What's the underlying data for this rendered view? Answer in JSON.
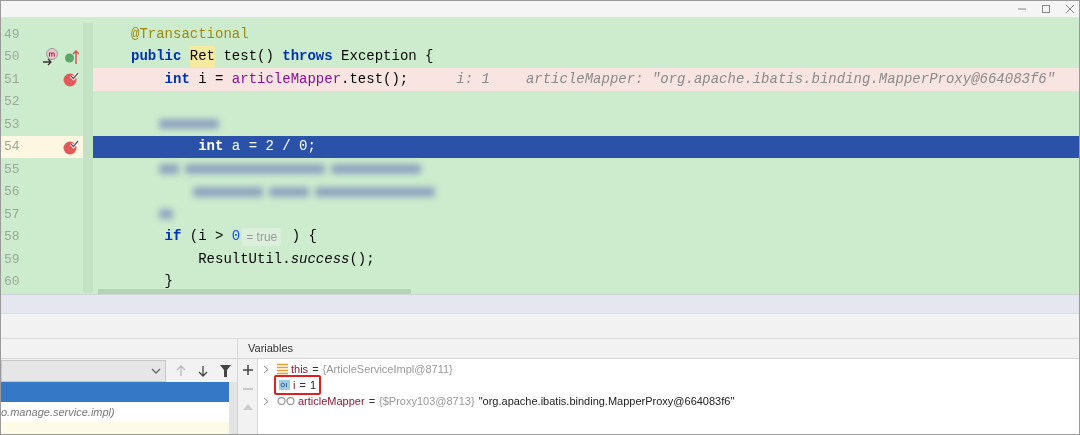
{
  "editor": {
    "lines": [
      {
        "number": "49",
        "breakpoint": false,
        "current": false,
        "blurred": false,
        "tokens": [
          {
            "kind": "annotation",
            "text": "@Transactional"
          }
        ]
      },
      {
        "number": "50",
        "breakpoint": false,
        "current": false,
        "blurred": false,
        "override": true,
        "implemented": true,
        "tokens": [
          {
            "kind": "keyword",
            "text": "public "
          },
          {
            "kind": "type",
            "text": "Ret"
          },
          {
            "kind": "plain",
            "text": " test() "
          },
          {
            "kind": "keyword",
            "text": "throws"
          },
          {
            "kind": "plain",
            "text": " Exception {"
          }
        ]
      },
      {
        "number": "51",
        "breakpoint": true,
        "current": false,
        "blurred": false,
        "tokens": [
          {
            "kind": "keyword",
            "text": "    int"
          },
          {
            "kind": "plain",
            "text": " i = "
          },
          {
            "kind": "field",
            "text": "articleMapper"
          },
          {
            "kind": "plain",
            "text": ".test();"
          }
        ],
        "hints": [
          "i: 1",
          "articleMapper: \"org.apache.ibatis.binding.MapperProxy@664083f6\""
        ]
      },
      {
        "number": "52",
        "breakpoint": false,
        "current": false,
        "blurred": false
      },
      {
        "number": "53",
        "breakpoint": false,
        "current": false,
        "blurred": true
      },
      {
        "number": "54",
        "breakpoint": true,
        "current": true,
        "blurred": false,
        "tokens": [
          {
            "kind": "keyword",
            "text": "        int"
          },
          {
            "kind": "plain",
            "text": " a = 2 / 0;"
          }
        ]
      },
      {
        "number": "55",
        "breakpoint": false,
        "current": false,
        "blurred": true
      },
      {
        "number": "56",
        "breakpoint": false,
        "current": false,
        "blurred": true
      },
      {
        "number": "57",
        "breakpoint": false,
        "current": false,
        "blurred": true
      },
      {
        "number": "58",
        "breakpoint": false,
        "current": false,
        "blurred": false,
        "tokens": [
          {
            "kind": "keyword",
            "text": "    if"
          },
          {
            "kind": "plain",
            "text": " (i > "
          },
          {
            "kind": "number",
            "text": "0"
          },
          {
            "kind": "inline-hint",
            "text": "= true"
          },
          {
            "kind": "plain",
            "text": " ) {"
          }
        ]
      },
      {
        "number": "59",
        "breakpoint": false,
        "current": false,
        "blurred": false,
        "tokens": [
          {
            "kind": "plain",
            "text": "        ResultUtil."
          },
          {
            "kind": "static",
            "text": "success"
          },
          {
            "kind": "plain",
            "text": "();"
          }
        ]
      },
      {
        "number": "60",
        "breakpoint": false,
        "current": false,
        "blurred": false,
        "tokens": [
          {
            "kind": "plain",
            "text": "    }"
          }
        ]
      }
    ]
  },
  "frames": {
    "items": [
      {
        "selected": true
      },
      {
        "label": "o.manage.service.impl)",
        "selected": false
      },
      {
        "selected": false,
        "kind": "library"
      }
    ]
  },
  "variables": {
    "title": "Variables",
    "rows": [
      {
        "kind": "object",
        "expandable": true,
        "highlighted": false,
        "name": "this",
        "operator": "=",
        "value": "{ArticleServiceImpl@8711}"
      },
      {
        "kind": "primitive",
        "expandable": false,
        "highlighted": true,
        "name": "i",
        "operator": "=",
        "value": "1"
      },
      {
        "kind": "proxy",
        "expandable": true,
        "highlighted": false,
        "name": "articleMapper",
        "operator": "=",
        "value": "{$Proxy103@8713}",
        "string": "\"org.apache.ibatis.binding.MapperProxy@664083f6\""
      }
    ]
  }
}
